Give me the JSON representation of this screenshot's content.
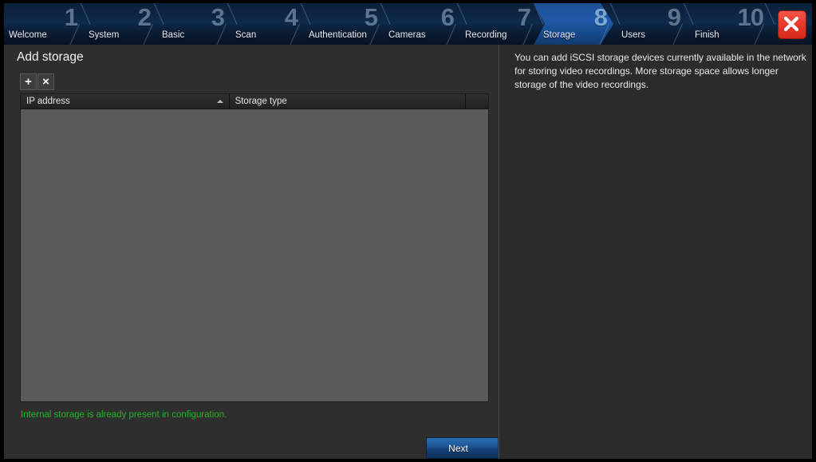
{
  "window": {
    "frame_color": "#000000",
    "background": "#2b2b2b"
  },
  "wizard": {
    "active_step": 8,
    "steps": [
      {
        "number": "1",
        "label": "Welcome"
      },
      {
        "number": "2",
        "label": "System"
      },
      {
        "number": "3",
        "label": "Basic"
      },
      {
        "number": "4",
        "label": "Scan"
      },
      {
        "number": "5",
        "label": "Authentication"
      },
      {
        "number": "6",
        "label": "Cameras"
      },
      {
        "number": "7",
        "label": "Recording"
      },
      {
        "number": "8",
        "label": "Storage"
      },
      {
        "number": "9",
        "label": "Users"
      },
      {
        "number": "10",
        "label": "Finish"
      }
    ],
    "close_label": "close-window",
    "accent_active": "#1e5aa8",
    "accent_close": "#e8392b"
  },
  "main": {
    "title": "Add storage",
    "toolbar": {
      "add_label": "+",
      "remove_label": "×"
    },
    "table": {
      "columns": [
        {
          "label": "IP address",
          "sorted": "asc"
        },
        {
          "label": "Storage type",
          "sorted": "none"
        },
        {
          "label": "",
          "sorted": "none"
        }
      ],
      "rows": []
    },
    "status_message": "Internal storage is already present in configuration.",
    "status_color": "#26b32a",
    "next_label": "Next"
  },
  "info": {
    "text": "You can add iSCSI storage devices currently available in the network for storing video recordings. More storage space allows longer storage of the video recordings."
  }
}
